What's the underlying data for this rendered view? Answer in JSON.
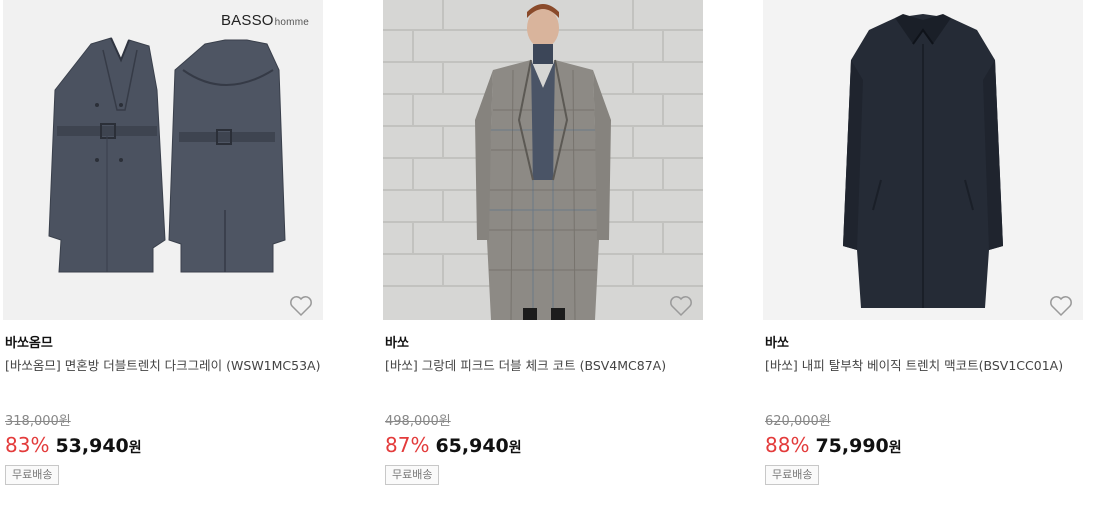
{
  "products": [
    {
      "image_logo": {
        "main": "BASSO",
        "sub": "homme"
      },
      "brand": "바쏘옴므",
      "title": "[바쏘옴므] 면혼방 더블트렌치 다크그레이 (WSW1MC53A)",
      "original_price": "318,000원",
      "discount_rate": "83%",
      "price": "53,940",
      "currency": "원",
      "shipping_tag": "무료배송",
      "wishlist_icon": "heart-outline-icon"
    },
    {
      "brand": "바쏘",
      "title": "[바쏘] 그랑데 피크드 더블 체크 코트 (BSV4MC87A)",
      "original_price": "498,000원",
      "discount_rate": "87%",
      "price": "65,940",
      "currency": "원",
      "shipping_tag": "무료배송",
      "wishlist_icon": "heart-outline-icon"
    },
    {
      "brand": "바쏘",
      "title": "[바쏘] 내피 탈부착 베이직 트렌치 맥코트(BSV1CC01A)",
      "original_price": "620,000원",
      "discount_rate": "88%",
      "price": "75,990",
      "currency": "원",
      "shipping_tag": "무료배송",
      "wishlist_icon": "heart-outline-icon"
    }
  ],
  "colors": {
    "discount": "#e33b3b",
    "price": "#111111",
    "strike": "#888888",
    "tag_border": "#c8c8c8"
  }
}
